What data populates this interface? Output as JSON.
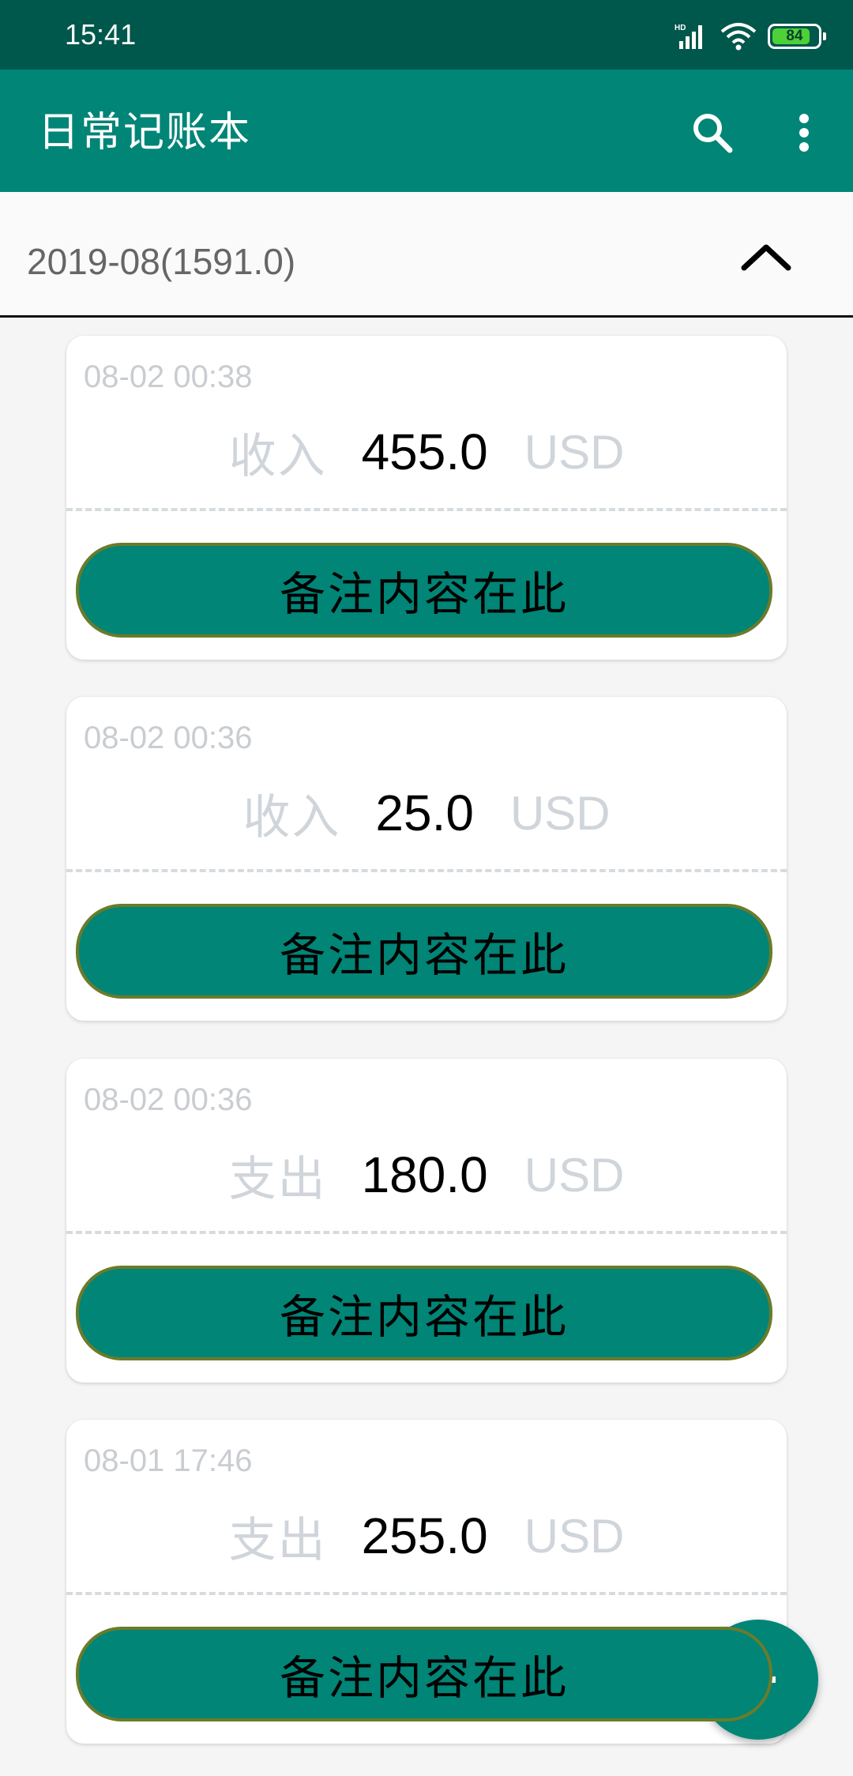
{
  "status_bar": {
    "time": "15:41",
    "battery_level": "84",
    "icons": [
      "hd-signal-icon",
      "wifi-icon",
      "battery-icon"
    ]
  },
  "app_bar": {
    "title": "日常记账本",
    "actions": [
      "search-icon",
      "more-vert-icon"
    ]
  },
  "month_header": {
    "label": "2019-08(1591.0)",
    "toggle_icon": "chevron-up-icon"
  },
  "entries": [
    {
      "time": "08-02 00:38",
      "type": "收入",
      "amount": "455.0",
      "currency": "USD",
      "note": "备注内容在此"
    },
    {
      "time": "08-02 00:36",
      "type": "收入",
      "amount": "25.0",
      "currency": "USD",
      "note": "备注内容在此"
    },
    {
      "time": "08-02 00:36",
      "type": "支出",
      "amount": "180.0",
      "currency": "USD",
      "note": "备注内容在此"
    },
    {
      "time": "08-01 17:46",
      "type": "支出",
      "amount": "255.0",
      "currency": "USD",
      "note": "备注内容在此"
    }
  ],
  "fab": {
    "icon": "add-icon"
  },
  "colors": {
    "primary": "#008577",
    "primary_dark": "#00574b",
    "note_border": "#6b7b2a",
    "muted_text": "#cfd5da"
  }
}
